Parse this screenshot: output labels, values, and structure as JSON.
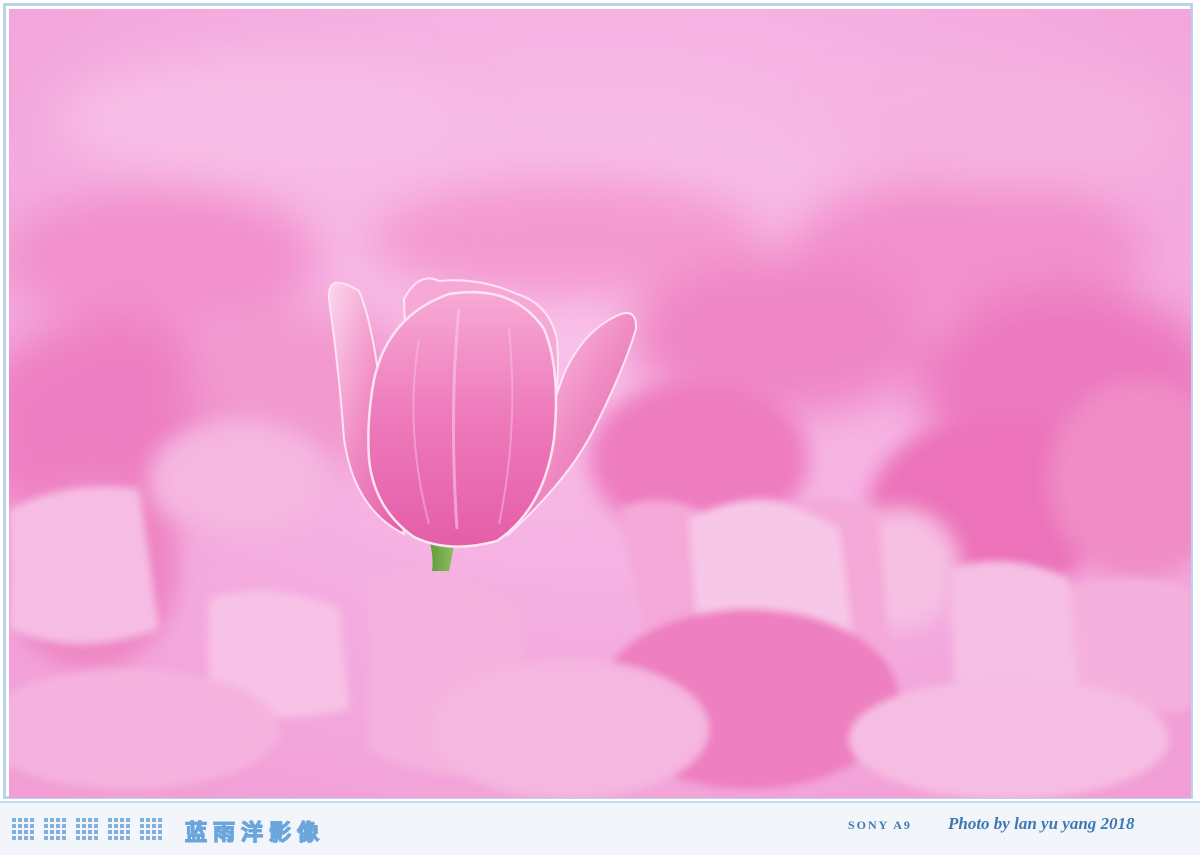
{
  "watermark": {
    "brand_text": "蓝雨洋影像",
    "camera_text": "SONY A9",
    "credit_text": "Photo by lan yu yang 2018"
  },
  "photo": {
    "subject": "tulip-field",
    "colors": {
      "background_pink": "#f5a8dd",
      "tulip_pink": "#ec6fb4",
      "petal_highlight": "#fde4f3",
      "stem_green": "#6fa84a"
    }
  },
  "frame": {
    "border_color": "#b9d3ea",
    "strip_background": "#f2f5fa",
    "dot_color": "#7fb1de",
    "text_color": "#3e78b3"
  }
}
